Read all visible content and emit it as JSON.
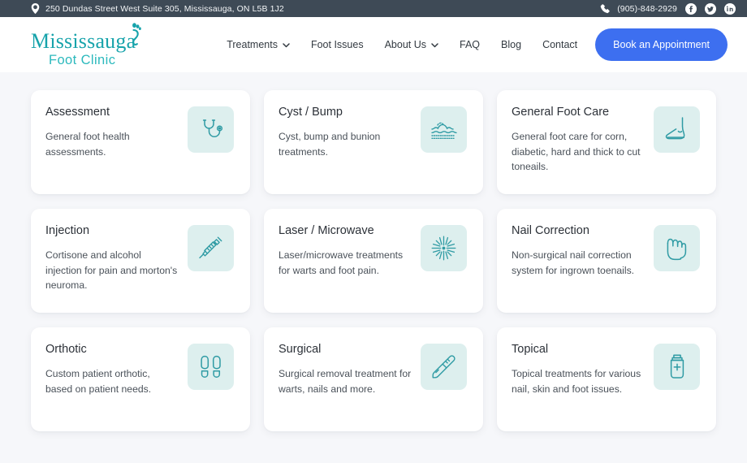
{
  "topbar": {
    "address": "250 Dundas Street West Suite 305, Mississauga, ON L5B 1J2",
    "phone": "(905)-848-2929",
    "location_icon": "map-pin-icon",
    "phone_icon": "phone-icon",
    "socials": [
      {
        "name": "facebook-icon",
        "label": "Facebook"
      },
      {
        "name": "twitter-icon",
        "label": "Twitter"
      },
      {
        "name": "linkedin-icon",
        "label": "LinkedIn"
      }
    ],
    "bg_color": "#3e4a56"
  },
  "header": {
    "logo": {
      "line1": "Mississauga",
      "line2": "Foot Clinic",
      "mark": "footprint-icon",
      "color": "#17a3ab"
    },
    "nav": [
      {
        "label": "Treatments",
        "has_dropdown": true
      },
      {
        "label": "Foot Issues",
        "has_dropdown": false
      },
      {
        "label": "About Us",
        "has_dropdown": true
      },
      {
        "label": "FAQ",
        "has_dropdown": false
      },
      {
        "label": "Blog",
        "has_dropdown": false
      },
      {
        "label": "Contact",
        "has_dropdown": false
      }
    ],
    "cta_label": "Book an Appointment",
    "cta_color": "#3d6ff0"
  },
  "treatments": {
    "icon_tile_bg": "#ddefee",
    "icon_stroke": "#2f9ba4",
    "cards": [
      {
        "title": "Assessment",
        "description": "General foot health assessments.",
        "icon": "stethoscope-icon"
      },
      {
        "title": "Cyst / Bump",
        "description": "Cyst, bump and bunion treatments.",
        "icon": "skin-bump-icon"
      },
      {
        "title": "General Foot Care",
        "description": "General foot care for corn, diabetic, hard and thick to cut toneails.",
        "icon": "foot-side-icon"
      },
      {
        "title": "Injection",
        "description": "Cortisone and alcohol injection for pain and morton's neuroma.",
        "icon": "syringe-icon"
      },
      {
        "title": "Laser / Microwave",
        "description": "Laser/microwave treatments for warts and foot pain.",
        "icon": "laser-burst-icon"
      },
      {
        "title": "Nail Correction",
        "description": "Non-surgical nail correction system for ingrown toenails.",
        "icon": "toes-icon"
      },
      {
        "title": "Orthotic",
        "description": "Custom patient orthotic, based on patient needs.",
        "icon": "insoles-icon"
      },
      {
        "title": "Surgical",
        "description": "Surgical removal treatment for warts, nails and more.",
        "icon": "scalpel-icon"
      },
      {
        "title": "Topical",
        "description": "Topical treatments for various nail, skin and foot issues.",
        "icon": "cream-tube-icon"
      }
    ]
  }
}
